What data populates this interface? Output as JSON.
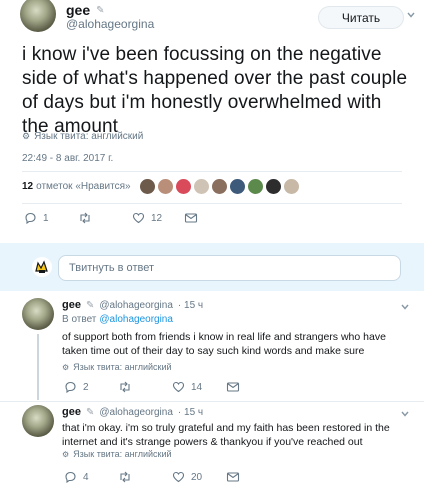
{
  "tweet": {
    "name": "gee",
    "handle": "@alohageorgina",
    "follow_label": "Читать",
    "text": "i know i've been focussing on the negative side of what's happened over the past couple of days but i'm honestly overwhelmed with the amount",
    "language": "Язык твита: английский",
    "timestamp": "22:49 - 8 авг. 2017 г.",
    "likes_count": "12",
    "likes_label": "отметок «Нравится»",
    "actions": {
      "replies": "1",
      "retweets": "",
      "likes": "12"
    }
  },
  "reply_box": {
    "placeholder": "Твитнуть в ответ"
  },
  "replies": [
    {
      "name": "gee",
      "handle": "@alohageorgina",
      "time": "· 15 ч",
      "in_reply_prefix": "В ответ",
      "in_reply_handle": "@alohageorgina",
      "text": "of support both from friends i know in real life and strangers who have taken time out of their day to say such kind words and make sure",
      "language": "Язык твита: английский",
      "replies": "2",
      "retweets": "",
      "likes": "14"
    },
    {
      "name": "gee",
      "handle": "@alohageorgina",
      "time": "· 15 ч",
      "text": "that i'm okay. i'm so truly grateful and my faith has been restored in the internet and it's strange powers & thankyou if you've reached out",
      "language": "Язык твита: английский",
      "replies": "4",
      "retweets": "",
      "likes": "20"
    }
  ],
  "colors": {
    "link": "#1b95e0",
    "secondary_text": "#657786",
    "divider": "#e6ecf0"
  }
}
